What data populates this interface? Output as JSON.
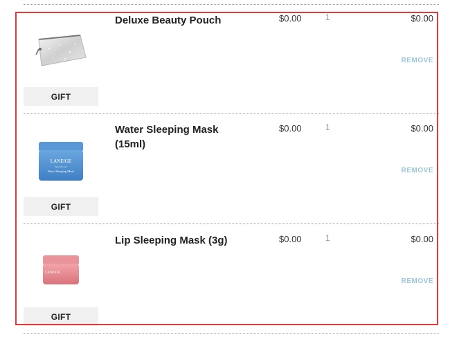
{
  "items": [
    {
      "name": "Deluxe Beauty Pouch",
      "price": "$0.00",
      "quantity": "1",
      "total": "$0.00",
      "remove_label": "REMOVE",
      "badge": "GIFT",
      "icon": "silver-pouch-icon"
    },
    {
      "name": "Water Sleeping Mask (15ml)",
      "price": "$0.00",
      "quantity": "1",
      "total": "$0.00",
      "remove_label": "REMOVE",
      "badge": "GIFT",
      "icon": "water-sleeping-mask-jar-icon",
      "product_text": {
        "brand": "LANEIGE",
        "line1": "Special Care",
        "line2": "Water Sleeping Mask"
      }
    },
    {
      "name": "Lip Sleeping Mask (3g)",
      "price": "$0.00",
      "quantity": "1",
      "total": "$0.00",
      "remove_label": "REMOVE",
      "badge": "GIFT",
      "icon": "lip-sleeping-mask-jar-icon",
      "product_text": {
        "brand": "LANEIGE"
      }
    }
  ],
  "colors": {
    "highlight_border": "#e5383b",
    "remove_link": "#9ac6d9",
    "gift_bg": "#f0f0f0"
  }
}
